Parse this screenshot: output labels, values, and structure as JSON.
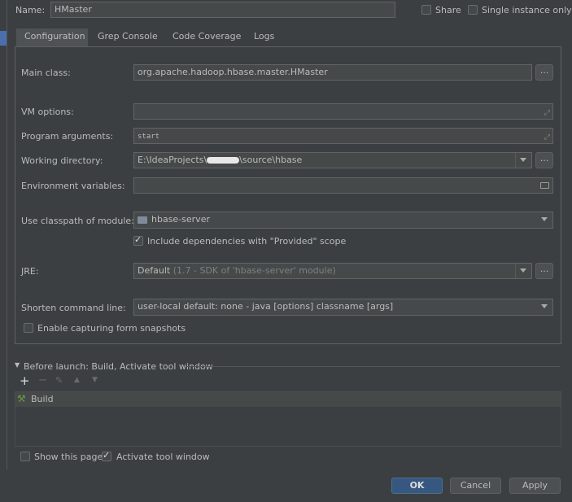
{
  "header": {
    "name_label": "Name:",
    "name_value": "HMaster",
    "share_label": "Share",
    "single_instance_label": "Single instance only"
  },
  "tabs": [
    {
      "label": "Configuration"
    },
    {
      "label": "Grep Console"
    },
    {
      "label": "Code Coverage"
    },
    {
      "label": "Logs"
    }
  ],
  "form": {
    "main_class_label": "Main class:",
    "main_class_value": "org.apache.hadoop.hbase.master.HMaster",
    "vm_options_label": "VM options:",
    "vm_options_value": "",
    "program_args_label": "Program arguments:",
    "program_args_value": "start",
    "working_dir_label": "Working directory:",
    "working_dir_prefix": "E:\\IdeaProjects\\",
    "working_dir_suffix": "\\source\\hbase",
    "env_vars_label": "Environment variables:",
    "env_vars_value": "",
    "classpath_label": "Use classpath of module:",
    "classpath_value": "hbase-server",
    "include_deps_label": "Include dependencies with \"Provided\" scope",
    "jre_label": "JRE:",
    "jre_default": "Default",
    "jre_detail": "(1.7 - SDK of 'hbase-server' module)",
    "shorten_label": "Shorten command line:",
    "shorten_value": "user-local default: none - java [options] classname [args]",
    "snapshots_label": "Enable capturing form snapshots",
    "ellipsis": "..."
  },
  "before_launch": {
    "title": "Before launch: Build, Activate tool window",
    "add": "+",
    "remove": "−",
    "items": [
      {
        "label": "Build"
      }
    ]
  },
  "footer": {
    "show_page_label": "Show this page",
    "activate_label": "Activate tool window",
    "ok": "OK",
    "cancel": "Cancel",
    "apply": "Apply"
  },
  "colors": {
    "ok_button": "#365880",
    "background": "#3c3f41"
  }
}
